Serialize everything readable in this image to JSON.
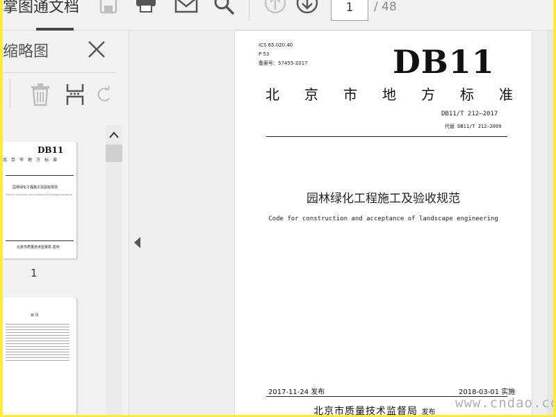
{
  "toolbar": {
    "title": "掌图通文档",
    "page_current": "1",
    "page_total": "/ 48"
  },
  "panel": {
    "title": "缩略图"
  },
  "thumbnails": [
    {
      "number": "1",
      "big": "DB11",
      "standard": "北京市地方标准",
      "title": "园林绿化工程施工及验收规范",
      "en": "Code for construction and acceptance of landscape engineering",
      "foot": "北京市质量技术监督局 发布"
    },
    {
      "heading": "目  次"
    }
  ],
  "document": {
    "ics": "ICS 65.020.40",
    "p": "P 53",
    "record": "备案号：57455-2017",
    "db_label": "DB11",
    "standard": [
      "北",
      "京",
      "市",
      "地",
      "方",
      "标",
      "准"
    ],
    "code": "DB11/T 212—2017",
    "replaces": "代替 DB11/T 212—2009",
    "title_cn": "园林绿化工程施工及验收规范",
    "title_en": "Code for construction and acceptance of landscape engineering",
    "issue_date": "2017-11-24 发布",
    "impl_date": "2018-03-01 实施",
    "issuer": "北京市质量技术监督局",
    "issuer_suffix": "发布"
  },
  "watermark": "www.cndao.com",
  "colors": {
    "border": "#ffeb3b",
    "background": "#f2f2f2",
    "page": "#ffffff",
    "text": "#222222"
  }
}
